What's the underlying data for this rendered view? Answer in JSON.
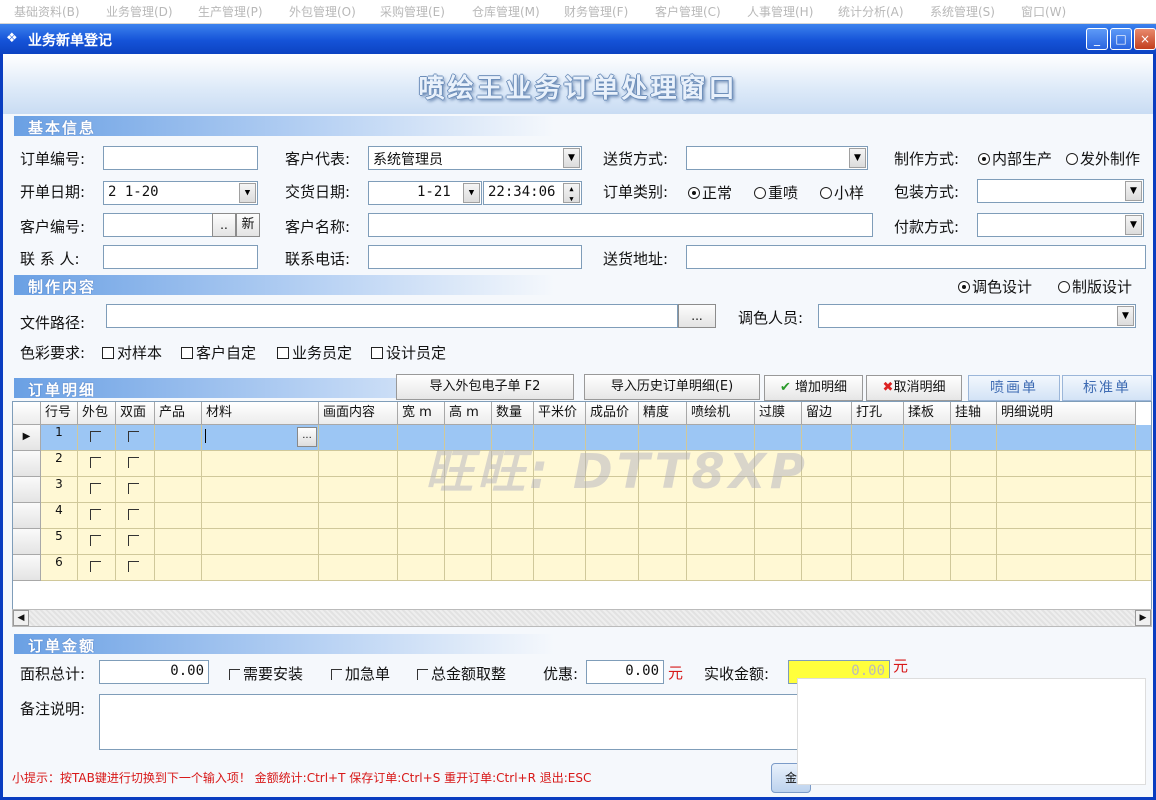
{
  "menu": [
    "基础资料(B)",
    "业务管理(D)",
    "生产管理(P)",
    "外包管理(O)",
    "采购管理(E)",
    "仓库管理(M)",
    "财务管理(F)",
    "客户管理(C)",
    "人事管理(H)",
    "统计分析(A)",
    "系统管理(S)",
    "窗口(W)"
  ],
  "window": {
    "title": "业务新单登记",
    "banner": "喷绘王业务订单处理窗口",
    "min": "_",
    "max": "□",
    "close": "×"
  },
  "basic": {
    "section": "基本信息",
    "order_no_label": "订单编号:",
    "order_no": "",
    "open_date_label": "开单日期:",
    "open_date": "2   1-20",
    "cust_no_label": "客户编号:",
    "cust_no": "",
    "browse_btn": "..",
    "new_btn": "新",
    "contact_label": "联 系 人:",
    "contact": "",
    "cust_rep_label": "客户代表:",
    "cust_rep": "系统管理员",
    "delivery_date_label": "交货日期:",
    "delivery_date": "1-21",
    "delivery_time": "22:34:06",
    "cust_name_label": "客户名称:",
    "cust_name": "",
    "phone_label": "联系电话:",
    "phone": "",
    "ship_method_label": "送货方式:",
    "ship_method": "",
    "order_type_label": "订单类别:",
    "order_types": [
      "正常",
      "重喷",
      "小样"
    ],
    "order_type_selected": "正常",
    "ship_addr_label": "送货地址:",
    "ship_addr": "",
    "make_method_label": "制作方式:",
    "make_methods": [
      "内部生产",
      "发外制作"
    ],
    "make_method_selected": "内部生产",
    "pack_label": "包装方式:",
    "pack": "",
    "pay_label": "付款方式:",
    "pay": ""
  },
  "content": {
    "section": "制作内容",
    "design_opts": [
      "调色设计",
      "制版设计"
    ],
    "design_selected": "调色设计",
    "file_path_label": "文件路径:",
    "file_path": "",
    "file_btn": "...",
    "color_person_label": "调色人员:",
    "color_person": "",
    "color_req_label": "色彩要求:",
    "color_reqs": [
      "对样本",
      "客户自定",
      "业务员定",
      "设计员定"
    ]
  },
  "detail": {
    "section": "订单明细",
    "import_outsource": "导入外包电子单 F2",
    "import_history": "导入历史订单明细(E)",
    "add_row": "增加明细",
    "cancel_row": "取消明细",
    "tabs": [
      "喷画单",
      "标准单"
    ],
    "columns": [
      "行号",
      "外包",
      "双面",
      "产品",
      "材料",
      "画面内容",
      "宽 m",
      "高 m",
      "数量",
      "平米价",
      "成品价",
      "精度",
      "喷绘机",
      "过膜",
      "留边",
      "打孔",
      "揉板",
      "挂轴",
      "明细说明"
    ],
    "rows": [
      "1",
      "2",
      "3",
      "4",
      "5",
      "6"
    ],
    "cell_btn": "...",
    "scroll_left": "◀",
    "scroll_right": "▶"
  },
  "amount": {
    "section": "订单金额",
    "area_label": "面积总计:",
    "area": "0.00",
    "install_label": "需要安装",
    "urgent_label": "加急单",
    "round_label": "总金额取整",
    "discount_label": "优惠:",
    "discount": "0.00",
    "currency": "元",
    "actual_label": "实收金额:",
    "actual": "0.00",
    "currency2": "元",
    "remark_label": "备注说明:",
    "remark": ""
  },
  "hint": "小提示：按TAB键进行切换到下一个输入项！ 金额统计:Ctrl+T  保存订单:Ctrl+S  重开订单:Ctrl+R  退出:ESC",
  "bottom_btn": "金",
  "watermark": "旺旺: DTT8XP",
  "colors": {
    "titlebar": "#1553d8",
    "section": "#6aa0e4",
    "row_alt": "#fff8d4",
    "row_selected": "#9cc6f4",
    "actual_bg": "#ffff3c",
    "hint": "#d81818"
  }
}
